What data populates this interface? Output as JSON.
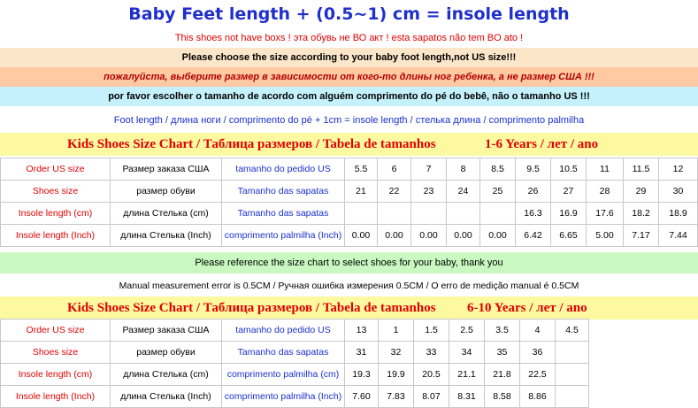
{
  "title": "Baby Feet length + (0.5~1) cm = insole length",
  "warning": "This shoes not have boxs !   эта обувь не ВО акт !   esta sapatos não tem BO ato !",
  "notice_en": "Please choose the size according to your baby foot length,not US size!!!",
  "notice_ru": "пожалуйста, выберите размер в зависимости от кого-то длины ног ребенка, а не размер США !!!",
  "notice_pt": "por favor escolher o tamanho de acordo com alguém comprimento do pé do bebê, não o tamanho US !!!",
  "formula": "Foot length / длина ноги / comprimento do pé + 1cm = insole length / стелька длина / comprimento palmilha",
  "chart1": {
    "heading": "Kids Shoes Size Chart / Таблица размеров /  Tabela de tamanhos",
    "age": "1-6 Years / лет / ano",
    "rows": [
      {
        "en": "Order US size",
        "ru": "Размер заказа США",
        "pt": "tamanho do pedido US",
        "values": [
          "5.5",
          "6",
          "7",
          "8",
          "8.5",
          "9.5",
          "10.5",
          "11",
          "11.5",
          "12"
        ]
      },
      {
        "en": "Shoes size",
        "ru": "размер обуви",
        "pt": "Tamanho das sapatas",
        "values": [
          "21",
          "22",
          "23",
          "24",
          "25",
          "26",
          "27",
          "28",
          "29",
          "30"
        ]
      },
      {
        "en": "Insole length (cm)",
        "ru": "длина Стелька (cm)",
        "pt": "Tamanho das sapatas",
        "values": [
          "",
          "",
          "",
          "",
          "",
          "16.3",
          "16.9",
          "17.6",
          "18.2",
          "18.9"
        ]
      },
      {
        "en": "Insole length (Inch)",
        "ru": "длина Стелька (Inch)",
        "pt": "comprimento palmilha (Inch)",
        "values": [
          "0.00",
          "0.00",
          "0.00",
          "0.00",
          "0.00",
          "6.42",
          "6.65",
          "5.00",
          "7.17",
          "7.44"
        ]
      }
    ]
  },
  "reference": "Please reference the size chart to select shoes for your baby, thank you",
  "measurement_error": "Manual measurement error is 0.5CM / Ручная ошибка измерения 0.5CM / O erro de medição manual é 0.5CM",
  "chart2": {
    "heading": "Kids Shoes Size Chart / Таблица размеров /  Tabela de tamanhos",
    "age": "6-10  Years / лет /  ano",
    "rows": [
      {
        "en": "Order US size",
        "ru": "Размер заказа США",
        "pt": "tamanho do pedido US",
        "values": [
          "13",
          "1",
          "1.5",
          "2.5",
          "3.5",
          "4",
          "4.5"
        ]
      },
      {
        "en": "Shoes size",
        "ru": "размер обуви",
        "pt": "Tamanho das sapatas",
        "values": [
          "31",
          "32",
          "33",
          "34",
          "35",
          "36",
          ""
        ]
      },
      {
        "en": "Insole length (cm)",
        "ru": "длина Стелька (cm)",
        "pt": "comprimento palmilha (cm)",
        "values": [
          "19.3",
          "19.9",
          "20.5",
          "21.1",
          "21.8",
          "22.5",
          ""
        ]
      },
      {
        "en": "Insole length (Inch)",
        "ru": "длина Стелька (Inch)",
        "pt": "comprimento palmilha (Inch)",
        "values": [
          "7.60",
          "7.83",
          "8.07",
          "8.31",
          "8.58",
          "8.86",
          ""
        ]
      }
    ]
  }
}
